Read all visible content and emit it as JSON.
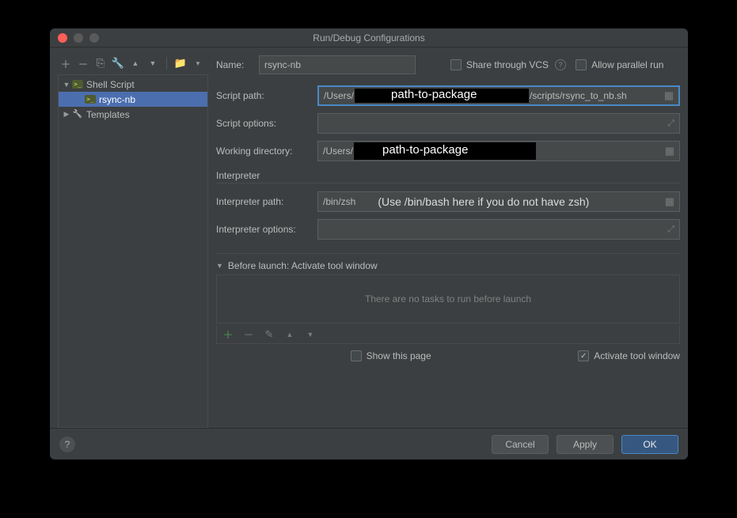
{
  "window": {
    "title": "Run/Debug Configurations"
  },
  "sidebar": {
    "toolbar_icons": [
      "add-icon",
      "remove-icon",
      "copy-icon",
      "wrench-icon",
      "up-arrow-icon",
      "down-arrow-icon",
      "folder-open-icon",
      "chevron-icon"
    ],
    "items": [
      {
        "label": "Shell Script",
        "type": "group",
        "expanded": true
      },
      {
        "label": "rsync-nb",
        "type": "config",
        "selected": true
      },
      {
        "label": "Templates",
        "type": "group",
        "expanded": false
      }
    ]
  },
  "form": {
    "name_label": "Name:",
    "name_value": "rsync-nb",
    "share_label": "Share through VCS",
    "share_checked": false,
    "parallel_label": "Allow parallel run",
    "parallel_checked": false,
    "script_path_label": "Script path:",
    "script_path_prefix": "/Users/",
    "script_path_overlay": "path-to-package",
    "script_path_suffix": "/scripts/rsync_to_nb.sh",
    "script_options_label": "Script options:",
    "script_options_value": "",
    "working_dir_label": "Working directory:",
    "working_dir_prefix": "/Users/",
    "working_dir_overlay": "path-to-package",
    "interpreter_section": "Interpreter",
    "interpreter_path_label": "Interpreter path:",
    "interpreter_path_value": "/bin/zsh",
    "interpreter_note": "(Use /bin/bash here if you do not have zsh)",
    "interpreter_options_label": "Interpreter options:",
    "interpreter_options_value": "",
    "before_launch_label": "Before launch: Activate tool window",
    "no_tasks_text": "There are no tasks to run before launch",
    "show_page_label": "Show this page",
    "show_page_checked": false,
    "activate_tool_label": "Activate tool window",
    "activate_tool_checked": true
  },
  "footer": {
    "cancel": "Cancel",
    "apply": "Apply",
    "ok": "OK"
  }
}
